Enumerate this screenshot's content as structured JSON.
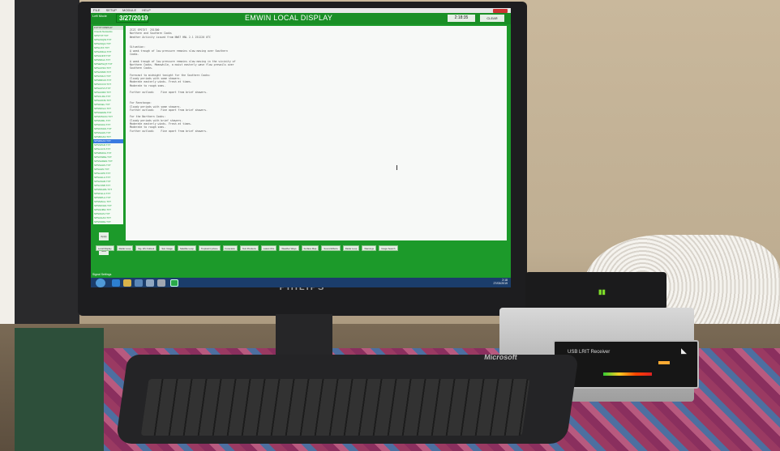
{
  "screen": {
    "menu": [
      "FILE",
      "SETUP",
      "MODULE",
      "HELP"
    ],
    "left_header": "Left Mode",
    "date": "3/27/2019",
    "title": "EMWIN LOCAL DISPLAY",
    "time": "2:18:35",
    "clear_label": "CLEAR",
    "list_header": "FCTXT DISPLAY",
    "list_items": [
      "Clouds Networks",
      "SPSTXT.TXT",
      "SPSASQW.TXT",
      "SPSASQA.TXT",
      "SPSLIXX.TXT",
      "SPSAMGA.TXT",
      "SPSGNNT.TXT",
      "SPSMIGA.TXT",
      "SPSEPGQT.TXT",
      "SPSAOSN.TXT",
      "SPSASMN.TXT",
      "SPSCMLX.TXT",
      "SPSRRGN.TXT",
      "SPSOCOV.TXT",
      "SPSAOVV.TXT",
      "SPSACRR.TXT",
      "SPSCLRA.TXT",
      "SPSAONS.TXT",
      "SPSFAEL.TXT",
      "SPSMOLA.TXT",
      "SPSGEMH.TXT",
      "SPSMTACN.TXT",
      "SPSMJRL.TXT",
      "SPSFADA.TXT",
      "SPSFINGS.TXT",
      "SPSSAHS.TXT",
      "SPSBOAN.TXT",
      "SPSRNAX.TXT",
      "SPSSPAR.TXT",
      "SPSLACS.TXT",
      "SPSRMOA.TXT",
      "SPSOWRE.TXT",
      "SPSSADEN.TXT",
      "SPSSAHS.TXT",
      "SPSAHN.TXT",
      "SPSLAPD.TXT",
      "SPSAHLA.TXT",
      "SPSASAR.TXT",
      "SPSLSSB.TXT",
      "SPSMGWA.TXT",
      "SPSFGLA.TXT",
      "SPSMPLA.TXT",
      "SPSMAGL.TXT",
      "SPSMOGN.TXT",
      "SPSGNBA.TXT",
      "SPSOIAS.TXT",
      "SPSAGAN.TXT",
      "SPSSNRE.TXT"
    ],
    "selected_index": 27,
    "small_buttons": [
      "Apply",
      "Next"
    ],
    "text_lines": [
      "ZCZC SPSTXT  251300",
      "Northern and Southern Cooks",
      "Weather Activity issued from NWS? HNL 2.1 251220 UTC",
      "",
      "",
      "Situation:",
      "A weak trough of low pressure remains slow moving over Southern",
      "Cooks.",
      "",
      "A weak trough of low pressure remains slow moving in the vicinity of",
      "Northern Cooks. Meanwhile, a moist easterly wave flow prevails over",
      "Southern Cooks.",
      "",
      "Forecast to midnight tonight for the Southern Cooks:",
      "Cloudy periods with some showers.",
      "Moderate easterly winds. Fresh at times.",
      "Moderate to rough seas.",
      "",
      "Further outlook:    Fine apart from brief showers.",
      "",
      "",
      "For Rarotonga:",
      "Cloudy periods with some showers.",
      "Further outlook:    Fine apart from brief showers.",
      "",
      "For the Northern Cooks:",
      "Cloudy periods with brief showers.",
      "Moderate easterly winds. Fresh at times.",
      "Moderate to rough seas.",
      "Further outlook:    Fine apart from brief showers."
    ],
    "bottom_buttons": [
      "Local Display",
      "Radar Loop",
      "Sig. Wx Outlook",
      "Sat. Image",
      "Satellite Loop",
      "Tropical Cyclone",
      "Forecasts",
      "Text Products",
      "Latest Obs",
      "Weather Ways",
      "Surface Map",
      "Sound Effects",
      "Radar Loop",
      "Warnings",
      "Image Search"
    ],
    "status_text": "Signal Settings",
    "tray_time": "2:18",
    "tray_date": "27/03/2019"
  },
  "monitor_brand": "PHILIPS",
  "keyboard_brand": "Microsoft",
  "receiver_label": "USB LRIT Receiver",
  "icons": [
    "start-orb-icon",
    "ie-icon",
    "explorer-icon",
    "media-icon",
    "shield-icon",
    "app-icon",
    "emwin-icon"
  ],
  "colors": {
    "screen_green": "#1c9a2a",
    "router_logo": "#7fdc2a"
  }
}
